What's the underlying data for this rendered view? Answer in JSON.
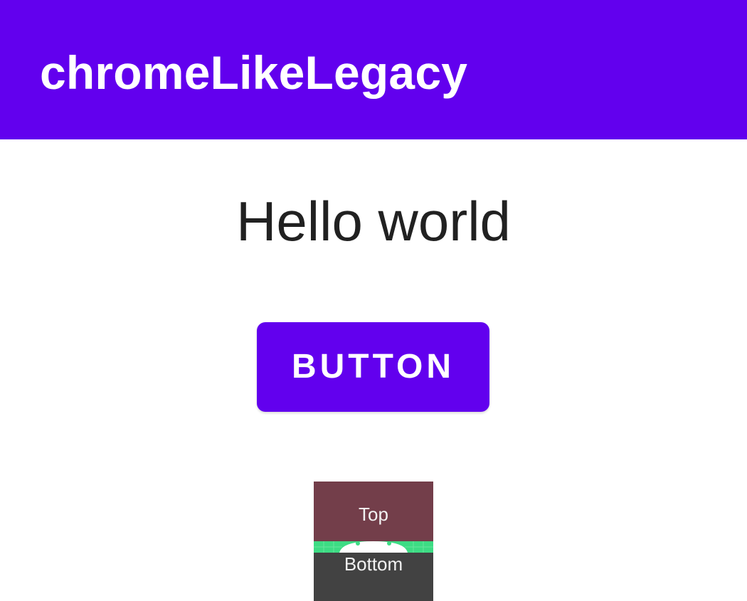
{
  "app_bar": {
    "title": "chromeLikeLegacy",
    "color": "#6200ee"
  },
  "main": {
    "greeting": "Hello world",
    "button_label": "BUTTON"
  },
  "widget": {
    "top_label": "Top",
    "bottom_label": "Bottom",
    "top_color": "#733e4a",
    "bottom_color": "#424242",
    "icon": "android-icon"
  }
}
